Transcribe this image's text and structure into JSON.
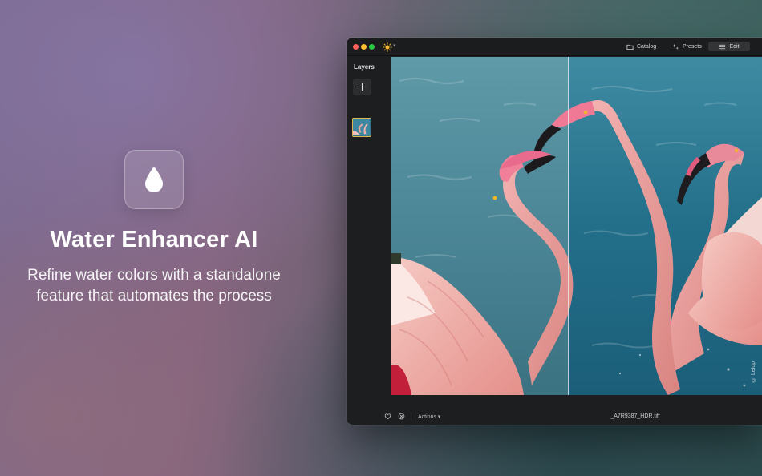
{
  "hero": {
    "icon": "water-drop-icon",
    "title": "Water Enhancer AI",
    "subtitle": "Refine water colors with a standalone feature that automates the process"
  },
  "window": {
    "app_icon": "sun-icon",
    "nav": {
      "catalog_label": "Catalog",
      "presets_label": "Presets",
      "edit_label": "Edit"
    },
    "sidebar": {
      "title": "Layers"
    },
    "canvas": {
      "watermark": "© Lelop"
    },
    "bottom": {
      "actions_label": "Actions",
      "filename": "_A7R9387_HDR.tiff"
    }
  },
  "colors": {
    "accent_thumb_border": "#e0b653",
    "window_bg": "#1d1e1f",
    "water_teal": "#2d6a80"
  }
}
